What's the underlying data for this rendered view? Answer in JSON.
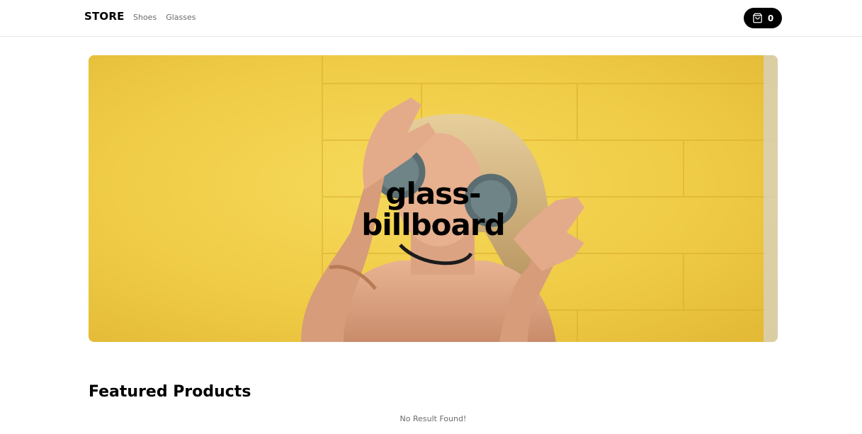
{
  "header": {
    "brand": "STORE",
    "nav": [
      {
        "label": "Shoes"
      },
      {
        "label": "Glasses"
      }
    ],
    "cart": {
      "count": "0",
      "icon": "shopping-bag-icon"
    }
  },
  "billboard": {
    "label": "glass-billboard",
    "background_color": "#f0cd4a"
  },
  "featured": {
    "title": "Featured Products",
    "empty_message": "No Result Found!"
  }
}
